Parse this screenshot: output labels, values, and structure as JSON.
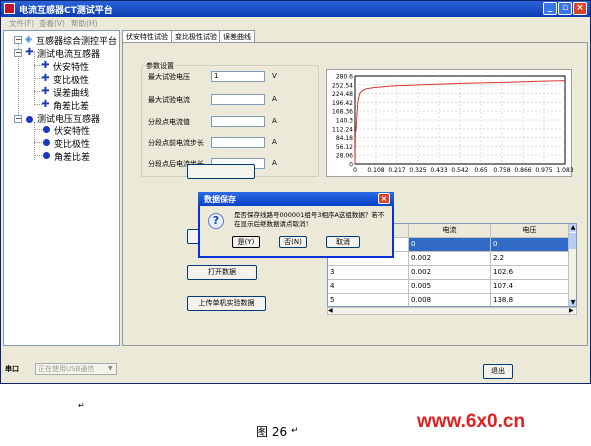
{
  "window": {
    "title": "电流互感器CT测试平台"
  },
  "menu": [
    "文件(F)",
    "查看(V)",
    "帮助(H)"
  ],
  "tree": {
    "root": "互感器综合测控平台",
    "ct": {
      "label": "测试电流互感器",
      "children": [
        "伏安特性",
        "变比极性",
        "误差曲线",
        "角差比差"
      ]
    },
    "pt": {
      "label": "测试电压互感器",
      "children": [
        "伏安特性",
        "变比极性",
        "角差比差"
      ]
    }
  },
  "tabs": [
    "伏安特性试验",
    "变比极性试验",
    "误差曲线"
  ],
  "params": {
    "group_title": "参数设置",
    "fields": [
      {
        "label": "最大试验电压",
        "value": "1",
        "unit": "V"
      },
      {
        "label": "最大试验电流",
        "value": "",
        "unit": "A"
      },
      {
        "label": "分段点电流值",
        "value": "",
        "unit": "A"
      },
      {
        "label": "分段点前电流步长",
        "value": "",
        "unit": "A"
      },
      {
        "label": "分段点后电流步长",
        "value": "",
        "unit": "A"
      }
    ]
  },
  "chart_data": {
    "type": "line",
    "y_ticks": [
      "280.6",
      "252.54",
      "224.48",
      "196.42",
      "168.36",
      "140.3",
      "112.24",
      "84.18",
      "56.12",
      "28.06",
      "0"
    ],
    "x_ticks": [
      "0",
      "0.108",
      "0.217",
      "0.325",
      "0.433",
      "0.542",
      "0.65",
      "0.758",
      "0.866",
      "0.975",
      "1.083"
    ],
    "xlim": [
      0,
      1.083
    ],
    "ylim": [
      0,
      280.6
    ],
    "grid": true,
    "series": [
      {
        "color": "#e03030",
        "x": [
          0,
          0.002,
          0.005,
          0.008,
          0.015,
          0.025,
          0.04,
          0.06,
          0.1,
          0.2,
          0.35,
          0.55,
          0.75,
          0.95,
          1.083
        ],
        "y": [
          0,
          102.6,
          107.4,
          138.8,
          200,
          225,
          235,
          240,
          244,
          249,
          253,
          257,
          260,
          264,
          266
        ]
      }
    ]
  },
  "buttons": {
    "open": "打开数据",
    "upload": "上传单机实验数据",
    "exit": "退出"
  },
  "table": {
    "headers": [
      "",
      "电流",
      "电压"
    ],
    "rows": [
      [
        "",
        "0",
        "0"
      ],
      [
        "",
        "0.002",
        "2.2"
      ],
      [
        "3",
        "0.002",
        "102.6"
      ],
      [
        "4",
        "0.005",
        "107.4"
      ],
      [
        "5",
        "0.008",
        "138.8"
      ]
    ]
  },
  "dialog": {
    "title": "数据保存",
    "message": "是否保存线路号000001组号3相序A这组数据？若不在显示后继数据请点取消！",
    "yes": "是(Y)",
    "no": "否(N)",
    "cancel": "取消"
  },
  "status": {
    "port_label": "串口",
    "port_value": "正在使用USB通信"
  },
  "caption": {
    "text": "图 26",
    "mark": "↵",
    "mark_left": "↵"
  },
  "watermark": "www.6x0.cn"
}
